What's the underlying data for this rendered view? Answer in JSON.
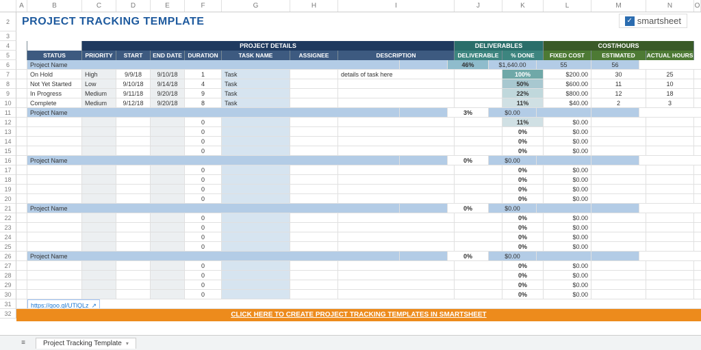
{
  "columns": [
    "A",
    "B",
    "C",
    "D",
    "E",
    "F",
    "G",
    "H",
    "I",
    "J",
    "K",
    "L",
    "M",
    "N",
    "O"
  ],
  "rowNumbers": [
    "2",
    "3",
    "4",
    "5",
    "6",
    "7",
    "8",
    "9",
    "10",
    "11",
    "12",
    "13",
    "14",
    "15",
    "16",
    "17",
    "18",
    "19",
    "20",
    "21",
    "22",
    "23",
    "24",
    "25",
    "26",
    "27",
    "28",
    "29",
    "30",
    "31",
    "32"
  ],
  "title": "PROJECT TRACKING TEMPLATE",
  "logo": "smartsheet",
  "headerGroups": {
    "project": "PROJECT DETAILS",
    "deliverables": "DELIVERABLES",
    "cost": "COST/HOURS"
  },
  "subHeaders": {
    "status": "STATUS",
    "priority": "PRIORITY",
    "start": "START DATE",
    "end": "END DATE",
    "duration": "DURATION",
    "task": "TASK NAME",
    "assignee": "ASSIGNEE",
    "description": "DESCRIPTION",
    "deliverable": "DELIVERABLE",
    "pctDone": "% DONE",
    "fixed": "FIXED COST",
    "est": "ESTIMATED HOURS",
    "actual": "ACTUAL HOURS"
  },
  "summary": {
    "projectName": "Project Name",
    "pct": "46%",
    "cost": "$1,640.00",
    "est": "55",
    "actual": "56"
  },
  "tasks": [
    {
      "status": "On Hold",
      "priority": "High",
      "start": "9/9/18",
      "end": "9/10/18",
      "duration": "1",
      "task": "Task",
      "assignee": "",
      "description": "details of task here",
      "deliverable": "",
      "pct": "100%",
      "cost": "$200.00",
      "est": "30",
      "actual": "25",
      "pctCls": "p100"
    },
    {
      "status": "Not Yet Started",
      "priority": "Low",
      "start": "9/10/18",
      "end": "9/14/18",
      "duration": "4",
      "task": "Task",
      "assignee": "",
      "description": "",
      "deliverable": "",
      "pct": "50%",
      "cost": "$600.00",
      "est": "11",
      "actual": "10",
      "pctCls": "p50"
    },
    {
      "status": "In Progress",
      "priority": "Medium",
      "start": "9/11/18",
      "end": "9/20/18",
      "duration": "9",
      "task": "Task",
      "assignee": "",
      "description": "",
      "deliverable": "",
      "pct": "22%",
      "cost": "$800.00",
      "est": "12",
      "actual": "18",
      "pctCls": "p22"
    },
    {
      "status": "Complete",
      "priority": "Medium",
      "start": "9/12/18",
      "end": "9/20/18",
      "duration": "8",
      "task": "Task",
      "assignee": "",
      "description": "",
      "deliverable": "",
      "pct": "11%",
      "cost": "$40.00",
      "est": "2",
      "actual": "3",
      "pctCls": "p11"
    }
  ],
  "groups": [
    {
      "name": "Project Name",
      "pct": "3%",
      "cost": "$0.00",
      "rows": [
        {
          "duration": "0",
          "pct": "11%",
          "cost": "$0.00",
          "pctCls": "p11"
        },
        {
          "duration": "0",
          "pct": "0%",
          "cost": "$0.00",
          "pctCls": "p0"
        },
        {
          "duration": "0",
          "pct": "0%",
          "cost": "$0.00",
          "pctCls": "p0"
        },
        {
          "duration": "0",
          "pct": "0%",
          "cost": "$0.00",
          "pctCls": "p0"
        }
      ]
    },
    {
      "name": "Project Name",
      "pct": "0%",
      "cost": "$0.00",
      "rows": [
        {
          "duration": "0",
          "pct": "0%",
          "cost": "$0.00",
          "pctCls": "p0"
        },
        {
          "duration": "0",
          "pct": "0%",
          "cost": "$0.00",
          "pctCls": "p0"
        },
        {
          "duration": "0",
          "pct": "0%",
          "cost": "$0.00",
          "pctCls": "p0"
        },
        {
          "duration": "0",
          "pct": "0%",
          "cost": "$0.00",
          "pctCls": "p0"
        }
      ]
    },
    {
      "name": "Project Name",
      "pct": "0%",
      "cost": "$0.00",
      "rows": [
        {
          "duration": "0",
          "pct": "0%",
          "cost": "$0.00",
          "pctCls": "p0"
        },
        {
          "duration": "0",
          "pct": "0%",
          "cost": "$0.00",
          "pctCls": "p0"
        },
        {
          "duration": "0",
          "pct": "0%",
          "cost": "$0.00",
          "pctCls": "p0"
        },
        {
          "duration": "0",
          "pct": "0%",
          "cost": "$0.00",
          "pctCls": "p0"
        }
      ]
    },
    {
      "name": "Project Name",
      "pct": "0%",
      "cost": "$0.00",
      "rows": [
        {
          "duration": "0",
          "pct": "0%",
          "cost": "$0.00",
          "pctCls": "p0"
        },
        {
          "duration": "0",
          "pct": "0%",
          "cost": "$0.00",
          "pctCls": "p0"
        },
        {
          "duration": "0",
          "pct": "0%",
          "cost": "$0.00",
          "pctCls": "p0"
        },
        {
          "duration": "0",
          "pct": "0%",
          "cost": "$0.00",
          "pctCls": "p0"
        }
      ]
    }
  ],
  "link": "https://goo.gl/UTlQLz",
  "banner": "CLICK HERE TO CREATE PROJECT TRACKING TEMPLATES IN SMARTSHEET",
  "sheetTab": "Project Tracking Template"
}
